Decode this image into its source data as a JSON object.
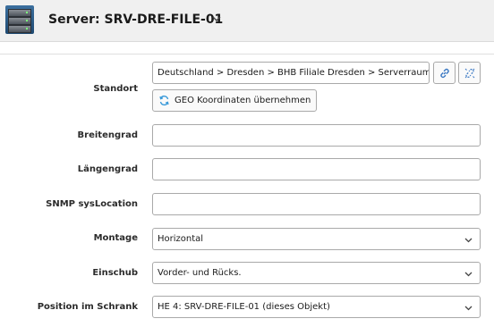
{
  "header": {
    "title": "Server: SRV-DRE-FILE-01",
    "icon": "server-icon"
  },
  "form": {
    "standort": {
      "label": "Standort",
      "value": "Deutschland > Dresden > BHB Filiale Dresden > Serverraum Dresden",
      "link_icon": "link-icon",
      "unlink_icon": "unlink-icon",
      "geo_button_label": "GEO Koordinaten übernehmen",
      "geo_icon": "refresh-icon"
    },
    "breitengrad": {
      "label": "Breitengrad",
      "value": ""
    },
    "laengengrad": {
      "label": "Längengrad",
      "value": ""
    },
    "snmp": {
      "label": "SNMP sysLocation",
      "value": ""
    },
    "montage": {
      "label": "Montage",
      "value": "Horizontal"
    },
    "einschub": {
      "label": "Einschub",
      "value": "Vorder- und Rücks."
    },
    "position": {
      "label": "Position im Schrank",
      "value": "HE 4: SRV-DRE-FILE-01 (dieses Objekt)"
    }
  },
  "colors": {
    "accent_blue": "#3a78c3",
    "header_bg": "#f0f0f0"
  }
}
